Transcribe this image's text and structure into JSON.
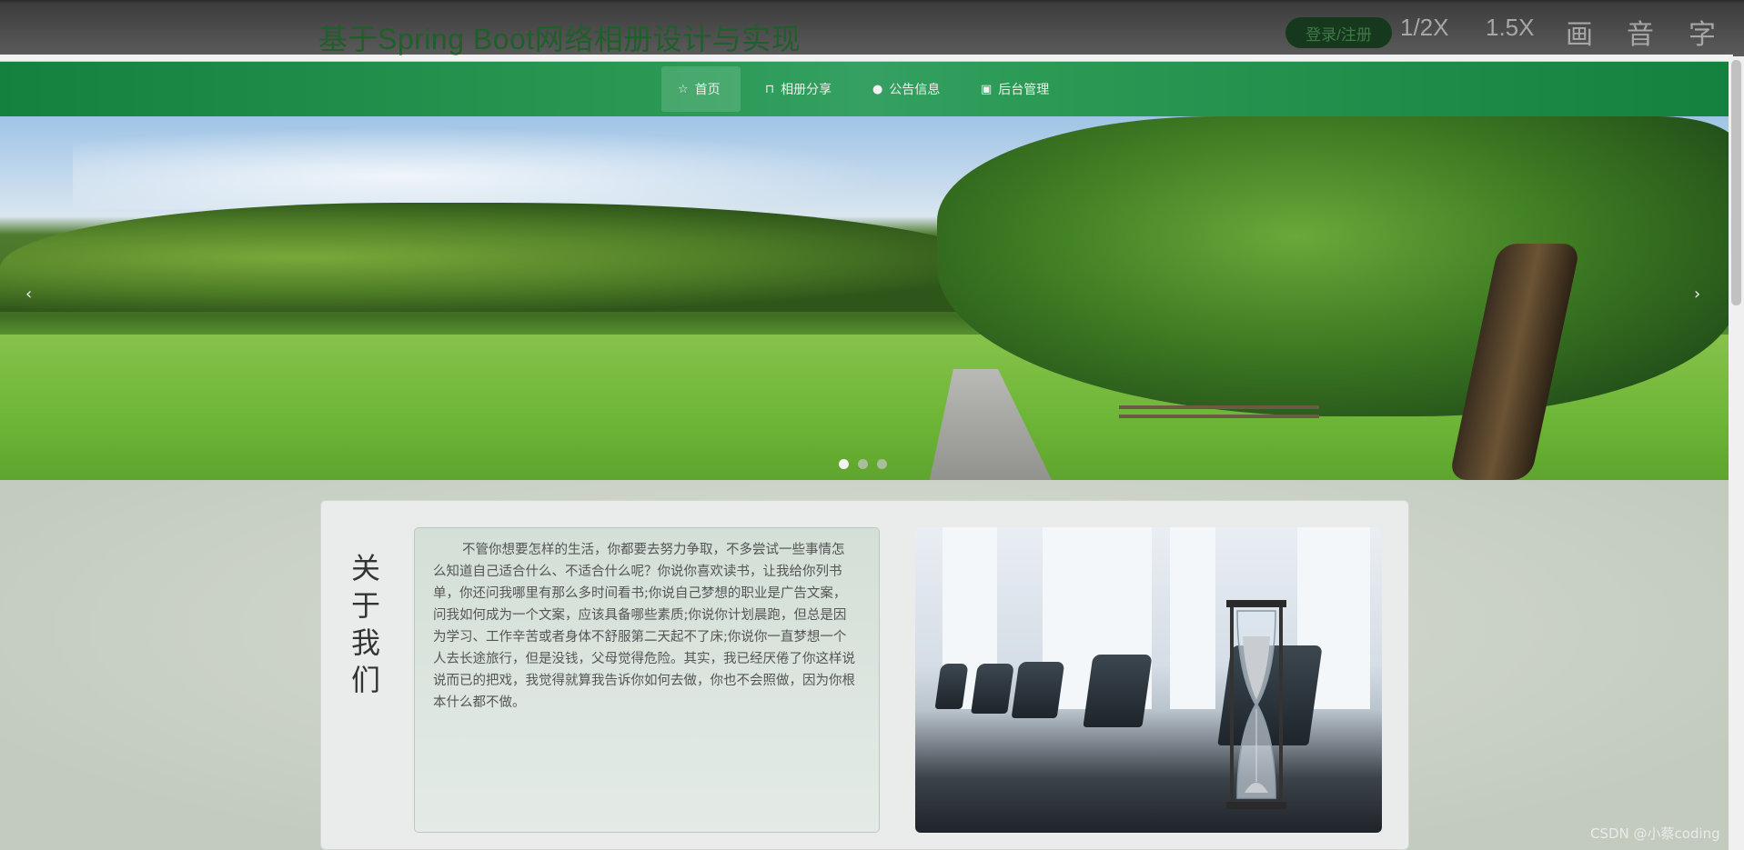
{
  "header": {
    "title": "基于Spring Boot网络相册设计与实现",
    "login_label": "登录/注册",
    "tools": [
      "1/2X",
      "1.5X",
      "画",
      "音",
      "字"
    ]
  },
  "nav": {
    "items": [
      {
        "label": "首页",
        "icon": "star-icon",
        "active": true
      },
      {
        "label": "相册分享",
        "icon": "bag-icon",
        "active": false
      },
      {
        "label": "公告信息",
        "icon": "info-icon",
        "active": false
      },
      {
        "label": "后台管理",
        "icon": "briefcase-icon",
        "active": false
      }
    ]
  },
  "carousel": {
    "prev_glyph": "‹",
    "next_glyph": "›",
    "slide_count": 3,
    "active_slide": 1
  },
  "about": {
    "title": "关于我们",
    "text": "不管你想要怎样的生活，你都要去努力争取，不多尝试一些事情怎么知道自己适合什么、不适合什么呢？你说你喜欢读书，让我给你列书单，你还问我哪里有那么多时间看书;你说自己梦想的职业是广告文案，问我如何成为一个文案，应该具备哪些素质;你说你计划晨跑，但总是因为学习、工作辛苦或者身体不舒服第二天起不了床;你说你一直梦想一个人去长途旅行，但是没钱，父母觉得危险。其实，我已经厌倦了你这样说说而已的把戏，我觉得就算我告诉你如何去做，你也不会照做，因为你根本什么都不做。"
  },
  "watermark": "CSDN @小蔡coding",
  "colors": {
    "nav_green": "#14823f",
    "title_green": "#1f5f2a",
    "login_bg": "#16381d"
  }
}
